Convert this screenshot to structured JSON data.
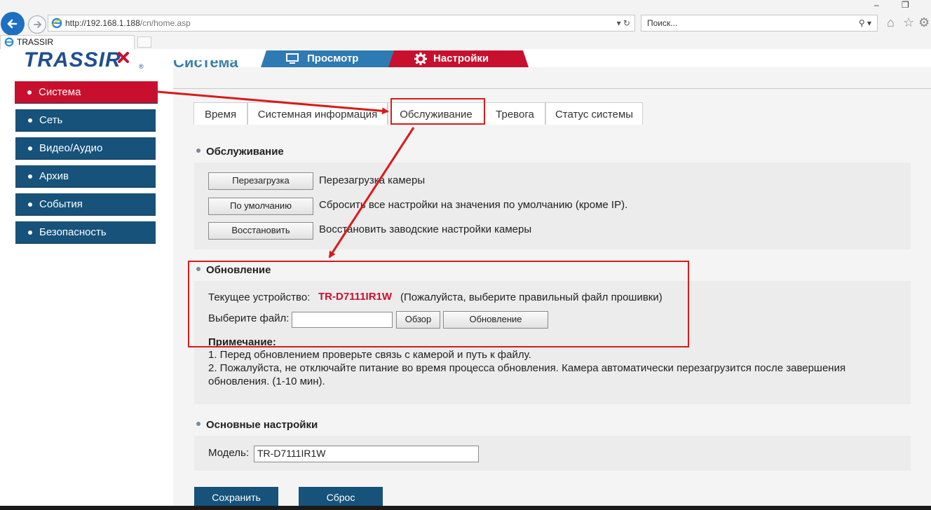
{
  "browser": {
    "url_host": "http://192.168.1.188",
    "url_path": "/cn/home.asp",
    "address_controls": "▾ ↻",
    "search_placeholder": "Поиск...",
    "search_controls": "⚲ ▾",
    "tab_title": "TRASSIR",
    "window_min": "–",
    "window_restore": "❐"
  },
  "header": {
    "logo_text": "TRASSIR",
    "tabs": [
      {
        "label": "Просмотр",
        "icon": "monitor-icon",
        "color": "#2e7ab3"
      },
      {
        "label": "Настройки",
        "icon": "gear-icon",
        "color": "#c8102e"
      }
    ],
    "page_title": "Система"
  },
  "sidebar": {
    "items": [
      {
        "label": "Система",
        "active": true
      },
      {
        "label": "Сеть"
      },
      {
        "label": "Видео/Аудио"
      },
      {
        "label": "Архив"
      },
      {
        "label": "События"
      },
      {
        "label": "Безопасность"
      }
    ]
  },
  "subtabs": [
    {
      "label": "Время"
    },
    {
      "label": "Системная информация"
    },
    {
      "label": "Обслуживание",
      "active": true
    },
    {
      "label": "Тревога"
    },
    {
      "label": "Статус системы"
    }
  ],
  "maintenance": {
    "title": "Обслуживание",
    "rows": [
      {
        "button": "Перезагрузка",
        "description": "Перезагрузка камеры"
      },
      {
        "button": "По умолчанию",
        "description": "Сбросить все настройки на значения по умолчанию (кроме IP)."
      },
      {
        "button": "Восстановить",
        "description": "Восстановить заводские настройки камеры"
      }
    ]
  },
  "update": {
    "title": "Обновление",
    "current_device_label": "Текущее устройство:",
    "current_device_value": "TR-D7111IR1W",
    "current_device_hint": "(Пожалуйста, выберите правильный файл прошивки)",
    "choose_file_label": "Выберите файл:",
    "file_value": "",
    "browse_button": "Обзор",
    "update_button": "Обновление",
    "note_title": "Примечание:",
    "note_1": "1. Перед обновлением проверьте связь с камерой и путь к файлу.",
    "note_2a": "2. Пожалуйста, не отключайте питание во время процесса обновления. Камера автоматически перезагрузится после завершения",
    "note_2b": "обновления. (1-10 мин)."
  },
  "basic": {
    "title": "Основные настройки",
    "model_label": "Модель:",
    "model_value": "TR-D7111IR1W"
  },
  "footer": {
    "save_button": "Сохранить",
    "reset_button": "Сброс"
  },
  "colors": {
    "accent_blue": "#16527a",
    "accent_red": "#c8102e",
    "annotation_red": "#d81b1b"
  }
}
